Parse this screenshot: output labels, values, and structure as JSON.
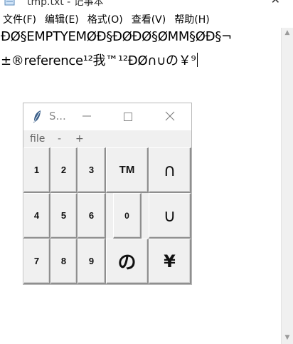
{
  "notepad": {
    "title": "tmp.txt - 记事本",
    "menus": [
      "文件(F)",
      "编辑(E)",
      "格式(O)",
      "查看(V)",
      "帮助(H)"
    ],
    "lines": [
      "ÐØ§EMPTYEMØÐ§ÐØÐØ§ØMM§ØÐ§¬",
      "±®reference¹²我™¹²ÐØ∩∪の￥⁹"
    ]
  },
  "tk_window": {
    "title": "S...",
    "menus": [
      "file",
      "-",
      "+"
    ],
    "buttons": {
      "b1": "1",
      "b2": "2",
      "b3": "3",
      "b_tm": "TM",
      "b_cap": "∩",
      "b4": "4",
      "b5": "5",
      "b6": "6",
      "b0": "0",
      "b_cup": "∪",
      "b7": "7",
      "b8": "8",
      "b9": "9",
      "b_no": "の",
      "b_yen": "¥"
    }
  }
}
